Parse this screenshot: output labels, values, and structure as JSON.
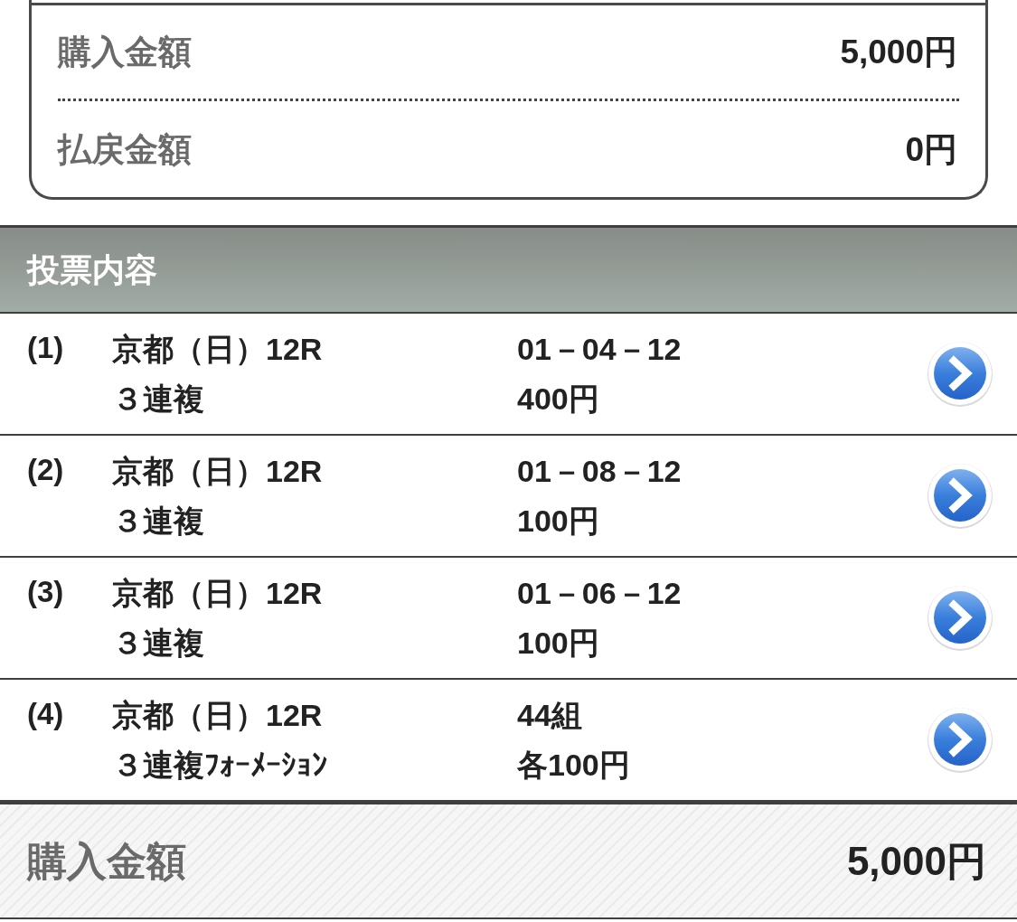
{
  "summary": {
    "rows": [
      {
        "label": "購入金額",
        "value": "5,000円"
      },
      {
        "label": "払戻金額",
        "value": "0円"
      }
    ]
  },
  "bets": {
    "title": "投票内容",
    "items": [
      {
        "number": "(1)",
        "race": "京都（日）12R",
        "bet_type": "３連複",
        "combination": "01－04－12",
        "amount": "400円"
      },
      {
        "number": "(2)",
        "race": "京都（日）12R",
        "bet_type": "３連複",
        "combination": "01－08－12",
        "amount": "100円"
      },
      {
        "number": "(3)",
        "race": "京都（日）12R",
        "bet_type": "３連複",
        "combination": "01－06－12",
        "amount": "100円"
      },
      {
        "number": "(4)",
        "race": "京都（日）12R",
        "bet_type": "３連複ﾌｫｰﾒｰｼｮﾝ",
        "combination": "44組",
        "amount": "各100円"
      }
    ]
  },
  "total": {
    "label": "購入金額",
    "value": "5,000円"
  }
}
